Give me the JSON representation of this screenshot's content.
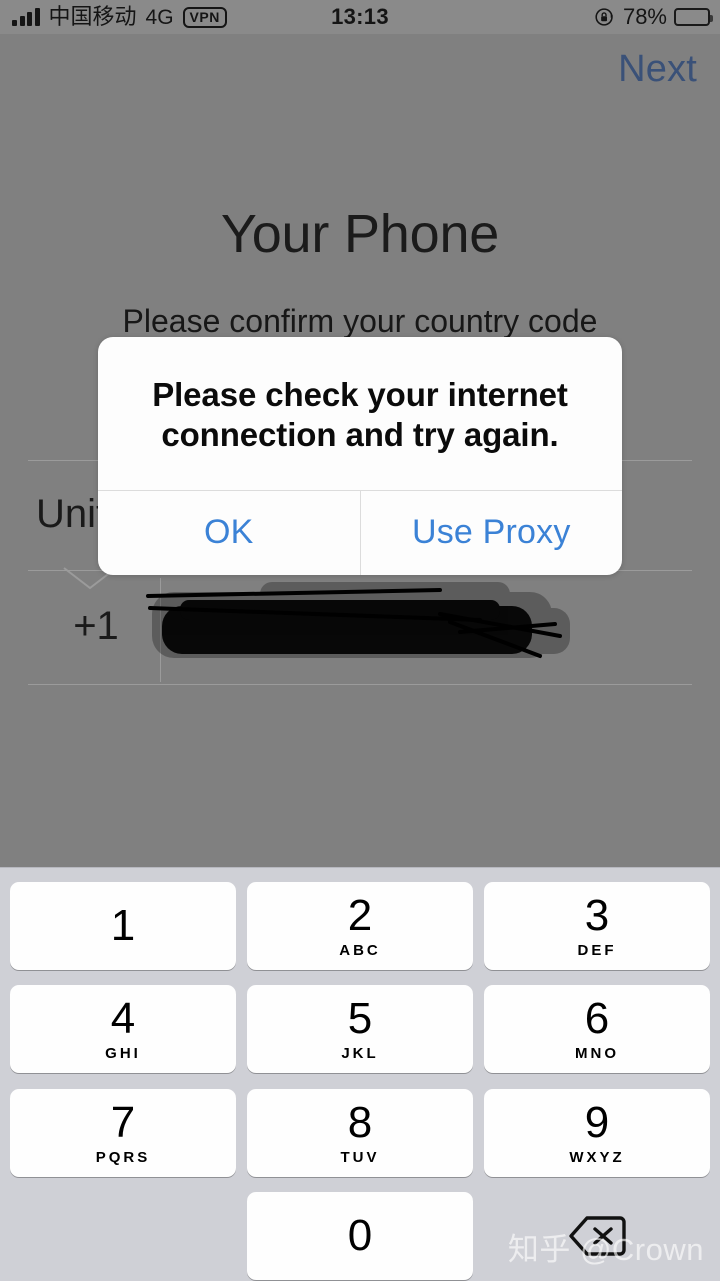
{
  "status_bar": {
    "carrier": "中国移动",
    "network": "4G",
    "vpn_badge": "VPN",
    "time": "13:13",
    "battery_percent": "78%",
    "rotation_lock_icon": "rotation-lock-icon",
    "signal_icon": "signal-bars-icon",
    "battery_icon": "battery-icon"
  },
  "nav": {
    "next_label": "Next"
  },
  "content": {
    "title": "Your Phone",
    "subtitle": "Please confirm your country code",
    "country_label": "United States",
    "country_label_visible": "Unit",
    "country_code": "+1",
    "phone_number": "",
    "phone_placeholder": ""
  },
  "alert": {
    "message": "Please check your internet connection and try again.",
    "buttons": [
      {
        "label": "OK"
      },
      {
        "label": "Use Proxy"
      }
    ]
  },
  "keypad": {
    "keys": [
      {
        "digit": "1",
        "letters": ""
      },
      {
        "digit": "2",
        "letters": "ABC"
      },
      {
        "digit": "3",
        "letters": "DEF"
      },
      {
        "digit": "4",
        "letters": "GHI"
      },
      {
        "digit": "5",
        "letters": "JKL"
      },
      {
        "digit": "6",
        "letters": "MNO"
      },
      {
        "digit": "7",
        "letters": "PQRS"
      },
      {
        "digit": "8",
        "letters": "TUV"
      },
      {
        "digit": "9",
        "letters": "WXYZ"
      },
      {
        "digit": "0",
        "letters": ""
      }
    ],
    "backspace_icon": "backspace-icon"
  },
  "watermark": "知乎 @Crown",
  "colors": {
    "dimmed_background": "#808080",
    "keypad_background": "#cfd0d6",
    "key_face": "#fefefe",
    "alert_button_blue": "#3b82d6",
    "next_button_blue": "#3a5178",
    "text_primary": "#1a1a1a"
  }
}
